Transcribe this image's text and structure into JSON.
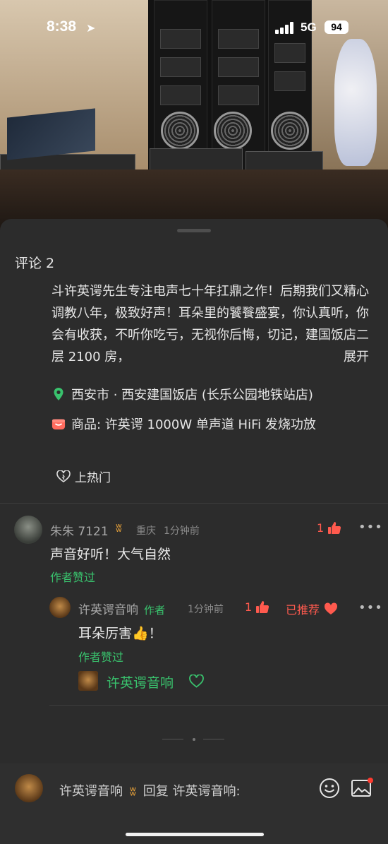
{
  "status_bar": {
    "time": "8:38",
    "network": "5G",
    "battery": "94"
  },
  "sheet": {
    "title": "评论 2"
  },
  "post": {
    "text": "斗许英谔先生专注电声七十年扛鼎之作！后期我们又精心调教八年，极致好声！耳朵里的饕餮盛宴，你认真听，你会有收获，不听你吃亏，无视你后悔，切记，建国饭店二层 2100 房，",
    "expand_label": "展开",
    "location": "西安市 · 西安建国饭店 (长乐公园地铁站店)",
    "product": "商品: 许英谔 1000W 单声道 HiFi 发烧功放",
    "hot_label": "上热门"
  },
  "comments": [
    {
      "user": "朱朱 7121",
      "location": "重庆",
      "time": "1分钟前",
      "likes": "1",
      "text": "声音好听！大气自然",
      "author_liked": "作者赞过",
      "replies": [
        {
          "user": "许英谔音响",
          "badge": "作者",
          "time": "1分钟前",
          "likes": "1",
          "recommended": "已推荐",
          "text": "耳朵厉害👍！",
          "author_liked": "作者赞过",
          "signature": "许英谔音响"
        }
      ]
    }
  ],
  "reply_bar": {
    "current_user": "许英谔音响",
    "action": "回复",
    "target": "许英谔音响:"
  },
  "colors": {
    "accent_green": "#39c26d",
    "accent_red": "#ff5a4e",
    "sheet_bg": "#2c2c2c"
  }
}
